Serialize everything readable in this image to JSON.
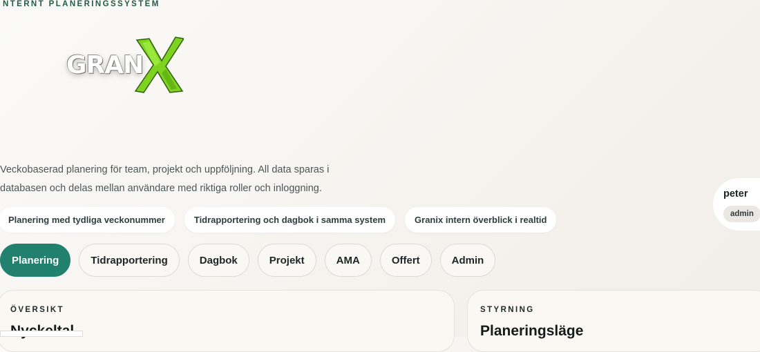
{
  "header": {
    "eyebrow": "NTERNT PLANERINGSSYSTEM",
    "logo_text": "GRAN"
  },
  "intro": {
    "line1": "Veckobaserad planering för team, projekt och uppföljning. All data sparas i",
    "line2": "databasen och delas mellan användare med riktiga roller och inloggning."
  },
  "features": [
    "Planering med tydliga veckonummer",
    "Tidrapportering och dagbok i samma system",
    "Granix intern överblick i realtid"
  ],
  "tabs": [
    {
      "label": "Planering",
      "active": true
    },
    {
      "label": "Tidrapportering",
      "active": false
    },
    {
      "label": "Dagbok",
      "active": false
    },
    {
      "label": "Projekt",
      "active": false
    },
    {
      "label": "AMA",
      "active": false
    },
    {
      "label": "Offert",
      "active": false
    },
    {
      "label": "Admin",
      "active": false
    }
  ],
  "user": {
    "name": "peter",
    "role": "admin"
  },
  "cards": {
    "overview": {
      "eyebrow": "ÖVERSIKT",
      "title": "Nyckeltal"
    },
    "control": {
      "eyebrow": "STYRNING",
      "title": "Planeringsläge"
    }
  },
  "colors": {
    "accent": "#21806e",
    "logo_green": "#7ed321"
  }
}
